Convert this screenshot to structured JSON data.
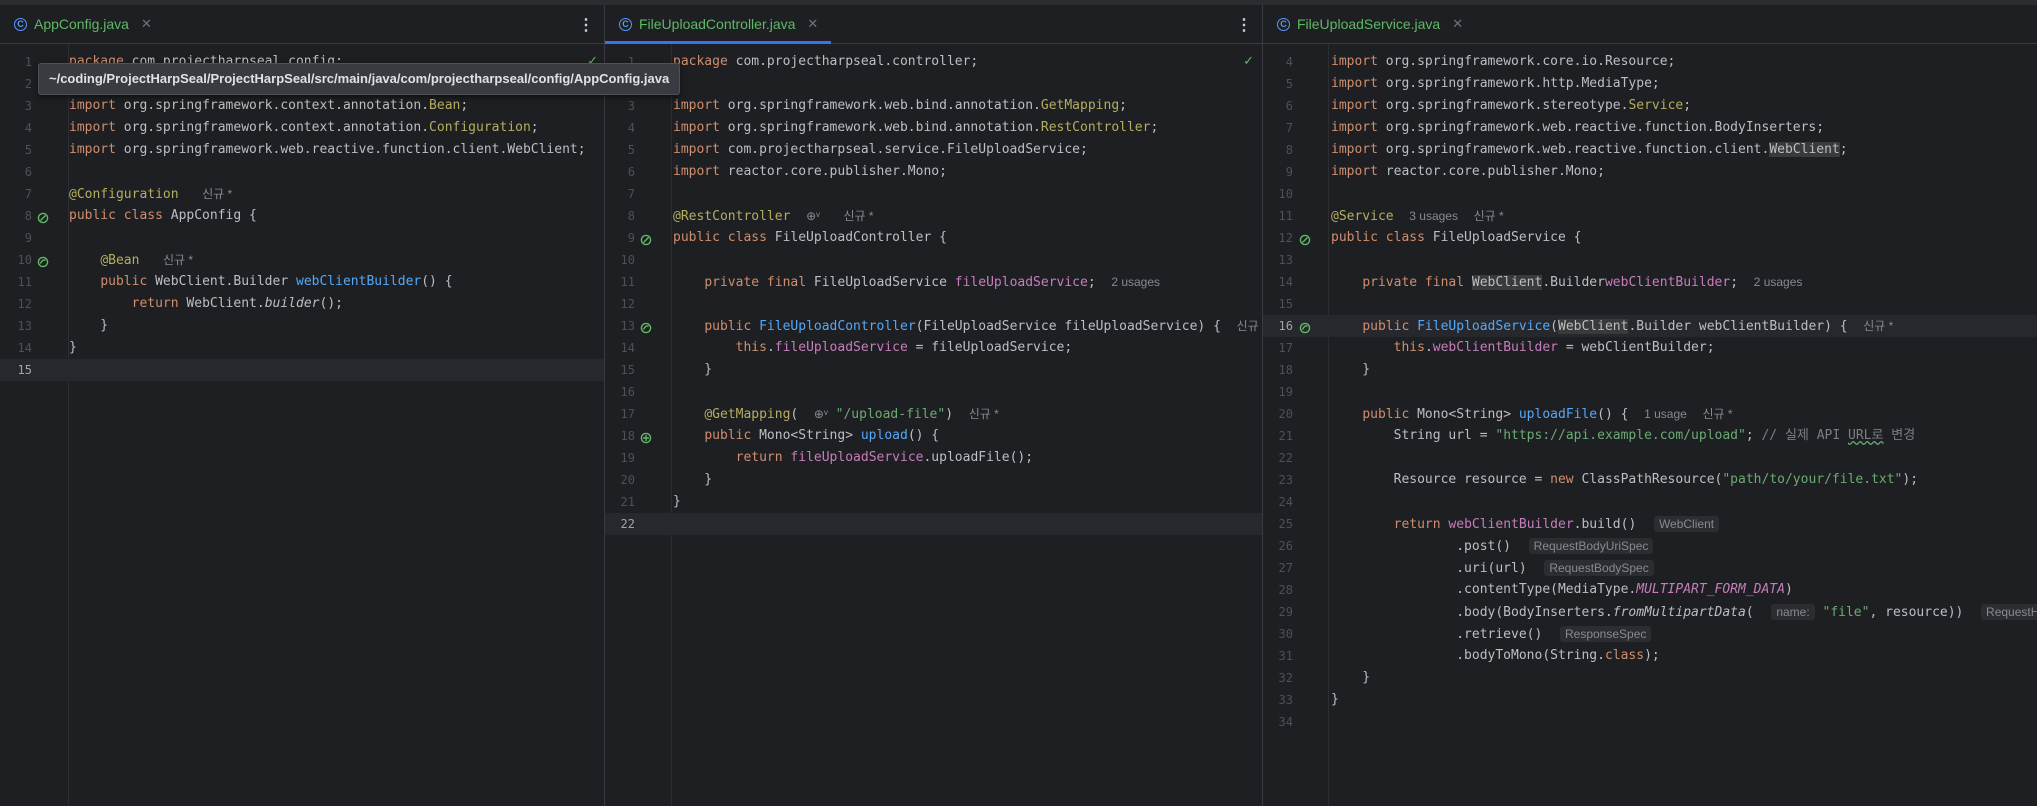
{
  "panes": [
    {
      "tab": {
        "title": "AppConfig.java",
        "icon": "class-icon",
        "active": false
      },
      "tooltip": "~/coding/ProjectHarpSeal/ProjectHarpSeal/src/main/java/com/projectharpseal/config/AppConfig.java",
      "first_line_number": 1,
      "current_line": 15,
      "gutter_icons": {
        "8": "bean-config-icon",
        "10": "bean-method-icon"
      },
      "lines": [
        [
          [
            "kw",
            "package"
          ],
          [
            "",
            "com.projectharpseal.config;"
          ]
        ],
        [],
        [
          [
            "kw",
            "import"
          ],
          [
            "",
            "org.springframework.context.annotation."
          ],
          [
            "an",
            "Bean"
          ],
          [
            "",
            ";"
          ]
        ],
        [
          [
            "kw",
            "import"
          ],
          [
            "",
            "org.springframework.context.annotation."
          ],
          [
            "an",
            "Configuration"
          ],
          [
            "",
            ";"
          ]
        ],
        [
          [
            "kw",
            "import"
          ],
          [
            "",
            "org.springframework.web.reactive.function.client.WebClient;"
          ]
        ],
        [],
        [
          [
            "an",
            "@Configuration"
          ],
          [
            "",
            ""
          ],
          [
            "hint",
            "신규 *"
          ]
        ],
        [
          [
            "kw",
            "public class"
          ],
          [
            "",
            "AppConfig {"
          ]
        ],
        [],
        [
          [
            "",
            "    "
          ],
          [
            "an",
            "@Bean"
          ],
          [
            "",
            ""
          ],
          [
            "hint",
            "신규 *"
          ]
        ],
        [
          [
            "",
            "    "
          ],
          [
            "kw",
            "public"
          ],
          [
            "",
            "WebClient.Builder"
          ],
          [
            "fn",
            "webClientBuilder"
          ],
          [
            "",
            "() {"
          ]
        ],
        [
          [
            "",
            "        "
          ],
          [
            "kw",
            "return"
          ],
          [
            "",
            "WebClient."
          ],
          [
            "ita",
            "builder"
          ],
          [
            "",
            "();"
          ]
        ],
        [
          [
            "",
            "    }"
          ]
        ],
        [
          [
            "",
            "}"
          ]
        ],
        []
      ]
    },
    {
      "tab": {
        "title": "FileUploadController.java",
        "icon": "class-icon",
        "active": true
      },
      "first_line_number": 1,
      "current_line": 22,
      "gutter_icons": {
        "9": "bean-config-icon",
        "13": "bean-method-icon",
        "18": "endpoint-icon"
      },
      "lines": [
        [
          [
            "kw",
            "package"
          ],
          [
            "",
            "com.projectharpseal.controller;"
          ]
        ],
        [],
        [
          [
            "kw",
            "import"
          ],
          [
            "",
            "org.springframework.web.bind.annotation."
          ],
          [
            "an",
            "GetMapping"
          ],
          [
            "",
            ";"
          ]
        ],
        [
          [
            "kw",
            "import"
          ],
          [
            "",
            "org.springframework.web.bind.annotation."
          ],
          [
            "an",
            "RestController"
          ],
          [
            "",
            ";"
          ]
        ],
        [
          [
            "kw",
            "import"
          ],
          [
            "",
            "com.projectharpseal.service.FileUploadService;"
          ]
        ],
        [
          [
            "kw",
            "import"
          ],
          [
            "",
            "reactor.core.publisher.Mono;"
          ]
        ],
        [],
        [
          [
            "an",
            "@RestController"
          ],
          [
            "hint",
            "⊕ᵛ"
          ],
          [
            "",
            ""
          ],
          [
            "hint",
            "신규 *"
          ]
        ],
        [
          [
            "kw",
            "public class"
          ],
          [
            "",
            "FileUploadController {"
          ]
        ],
        [],
        [
          [
            "",
            "    "
          ],
          [
            "kw",
            "private final"
          ],
          [
            "",
            "FileUploadService"
          ],
          [
            "fld",
            "fileUploadService"
          ],
          [
            "",
            ";"
          ],
          [
            "hint",
            "2 usages"
          ]
        ],
        [],
        [
          [
            "",
            "    "
          ],
          [
            "kw",
            "public"
          ],
          [
            "fn",
            "FileUploadController"
          ],
          [
            "",
            "(FileUploadService fileUploadService) {"
          ],
          [
            "hint",
            "신규 *"
          ]
        ],
        [
          [
            "",
            "        "
          ],
          [
            "kw",
            "this"
          ],
          [
            "",
            "."
          ],
          [
            "fld",
            "fileUploadService"
          ],
          [
            "",
            "= fileUploadService;"
          ]
        ],
        [
          [
            "",
            "    }"
          ]
        ],
        [],
        [
          [
            "",
            "    "
          ],
          [
            "an",
            "@GetMapping"
          ],
          [
            "",
            "("
          ],
          [
            "hint",
            "⊕ᵛ"
          ],
          [
            "str",
            "\"/upload-file\""
          ],
          [
            "",
            ")"
          ],
          [
            "hint",
            "신규 *"
          ]
        ],
        [
          [
            "",
            "    "
          ],
          [
            "kw",
            "public"
          ],
          [
            "",
            "Mono<String>"
          ],
          [
            "fn",
            "upload"
          ],
          [
            "",
            "() {"
          ]
        ],
        [
          [
            "",
            "        "
          ],
          [
            "kw",
            "return"
          ],
          [
            "fld",
            "fileUploadService"
          ],
          [
            "",
            ".uploadFile();"
          ]
        ],
        [
          [
            "",
            "    }"
          ]
        ],
        [
          [
            "",
            "}"
          ]
        ],
        []
      ]
    },
    {
      "tab": {
        "title": "FileUploadService.java",
        "icon": "class-icon",
        "active": false
      },
      "first_line_number": 4,
      "current_line": 16,
      "gutter_icons": {
        "12": "bean-config-icon",
        "16": "bean-method-icon"
      },
      "lines": [
        [
          [
            "kw",
            "import"
          ],
          [
            "",
            "org.springframework.core.io.Resource;"
          ]
        ],
        [
          [
            "kw",
            "import"
          ],
          [
            "",
            "org.springframework.http.MediaType;"
          ]
        ],
        [
          [
            "kw",
            "import"
          ],
          [
            "",
            "org.springframework.stereotype."
          ],
          [
            "an",
            "Service"
          ],
          [
            "",
            ";"
          ]
        ],
        [
          [
            "kw",
            "import"
          ],
          [
            "",
            "org.springframework.web.reactive.function.BodyInserters;"
          ]
        ],
        [
          [
            "kw",
            "import"
          ],
          [
            "",
            "org.springframework.web.reactive.function.client."
          ],
          [
            "hl",
            "WebClient"
          ],
          [
            "",
            ";"
          ]
        ],
        [
          [
            "kw",
            "import"
          ],
          [
            "",
            "reactor.core.publisher.Mono;"
          ]
        ],
        [],
        [
          [
            "an",
            "@Service"
          ],
          [
            "hint",
            "3 usages"
          ],
          [
            "hint",
            "신규 *"
          ]
        ],
        [
          [
            "kw",
            "public class"
          ],
          [
            "",
            "FileUploadService {"
          ]
        ],
        [],
        [
          [
            "",
            "    "
          ],
          [
            "kw",
            "private final"
          ],
          [
            "hl",
            "WebClient"
          ],
          [
            ".",
            ".Builder"
          ],
          [
            "fld",
            "webClientBuilder"
          ],
          [
            "",
            ";"
          ],
          [
            "hint",
            "2 usages"
          ]
        ],
        [],
        [
          [
            "",
            "    "
          ],
          [
            "kw",
            "public"
          ],
          [
            "fn",
            "FileUploadService"
          ],
          [
            "",
            "("
          ],
          [
            "hl",
            "WebClient"
          ],
          [
            ".",
            ".Builder webClientBuilder) {"
          ],
          [
            "hint",
            "신규 *"
          ]
        ],
        [
          [
            "",
            "        "
          ],
          [
            "kw",
            "this"
          ],
          [
            "",
            "."
          ],
          [
            "fld",
            "webClientBuilder"
          ],
          [
            "",
            "= webClientBuilder;"
          ]
        ],
        [
          [
            "",
            "    }"
          ]
        ],
        [],
        [
          [
            "",
            "    "
          ],
          [
            "kw",
            "public"
          ],
          [
            "",
            "Mono<String>"
          ],
          [
            "fn",
            "uploadFile"
          ],
          [
            "",
            "() {"
          ],
          [
            "hint",
            "1 usage"
          ],
          [
            "hint",
            "신규 *"
          ]
        ],
        [
          [
            "",
            "        String url = "
          ],
          [
            "str",
            "\"https://api.example.com/upload\""
          ],
          [
            "",
            ";"
          ],
          [
            "cmt",
            "// 실제 API "
          ],
          [
            "cmtul",
            "URL로"
          ],
          [
            "cmt",
            " 변경"
          ]
        ],
        [],
        [
          [
            "",
            "        Resource resource = "
          ],
          [
            "kw",
            "new"
          ],
          [
            "",
            "ClassPathResource("
          ],
          [
            "str",
            "\"path/to/your/file.txt\""
          ],
          [
            "",
            ");"
          ]
        ],
        [],
        [
          [
            "",
            "        "
          ],
          [
            "kw",
            "return"
          ],
          [
            "fld",
            "webClientBuilder"
          ],
          [
            "",
            ".build()"
          ],
          [
            "chip",
            "WebClient"
          ]
        ],
        [
          [
            "",
            "                .post()"
          ],
          [
            "chip",
            "RequestBodyUriSpec"
          ]
        ],
        [
          [
            "",
            "                .uri(url)"
          ],
          [
            "chip",
            "RequestBodySpec"
          ]
        ],
        [
          [
            "",
            "                .contentType(MediaType."
          ],
          [
            "cst",
            "MULTIPART_FORM_DATA"
          ],
          [
            "",
            ")"
          ]
        ],
        [
          [
            "",
            "                .body(BodyInserters."
          ],
          [
            "ita",
            "fromMultipartData"
          ],
          [
            "",
            "("
          ],
          [
            "chip",
            "name:"
          ],
          [
            "str",
            "\"file\""
          ],
          [
            "",
            ", resource))"
          ],
          [
            "chip",
            "RequestHeadersSpec"
          ]
        ],
        [
          [
            "",
            "                .retrieve()"
          ],
          [
            "chip",
            "ResponseSpec"
          ]
        ],
        [
          [
            "",
            "                .bodyToMono(String."
          ],
          [
            "kw",
            "class"
          ],
          [
            "",
            ");"
          ]
        ],
        [
          [
            "",
            "    }"
          ]
        ],
        [
          [
            "",
            "}"
          ]
        ],
        []
      ]
    }
  ]
}
